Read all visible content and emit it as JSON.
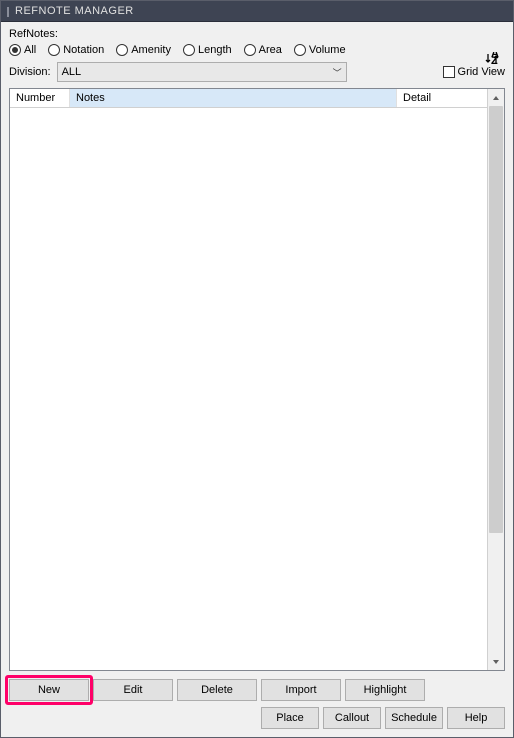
{
  "window": {
    "title": "REFNOTE MANAGER"
  },
  "labels": {
    "refnotes": "RefNotes:",
    "division": "Division:",
    "gridview": "Grid View"
  },
  "filters": {
    "items": [
      {
        "label": "All",
        "checked": true
      },
      {
        "label": "Notation",
        "checked": false
      },
      {
        "label": "Amenity",
        "checked": false
      },
      {
        "label": "Length",
        "checked": false
      },
      {
        "label": "Area",
        "checked": false
      },
      {
        "label": "Volume",
        "checked": false
      }
    ]
  },
  "division": {
    "selected": "ALL"
  },
  "table": {
    "columns": {
      "number": "Number",
      "notes": "Notes",
      "detail": "Detail"
    }
  },
  "buttons": {
    "row1": {
      "new": "New",
      "edit": "Edit",
      "delete": "Delete",
      "import": "Import",
      "highlight": "Highlight"
    },
    "row2": {
      "place": "Place",
      "callout": "Callout",
      "schedule": "Schedule",
      "help": "Help"
    }
  }
}
